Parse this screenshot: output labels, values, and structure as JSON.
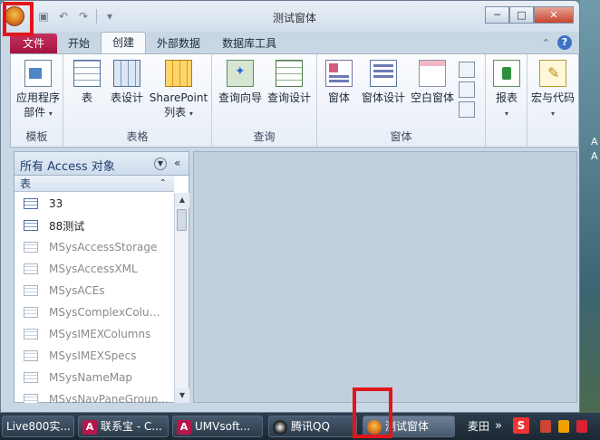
{
  "window": {
    "title": "测试窗体",
    "controls": {
      "minimize": "─",
      "maximize": "□",
      "close": "✕"
    }
  },
  "qat": {
    "undo": "↶",
    "redo": "↷"
  },
  "ribbon": {
    "tabs": [
      {
        "label": "文件"
      },
      {
        "label": "开始"
      },
      {
        "label": "创建"
      },
      {
        "label": "外部数据"
      },
      {
        "label": "数据库工具"
      }
    ],
    "help": "?",
    "groups": [
      {
        "name": "模板",
        "buttons": [
          {
            "label": "应用程序",
            "label2": "部件",
            "icon": "app-parts-icon"
          }
        ]
      },
      {
        "name": "表格",
        "buttons": [
          {
            "label": "表",
            "icon": "table-icon"
          },
          {
            "label": "表设计",
            "icon": "table-design-icon"
          },
          {
            "label": "SharePoint",
            "label2": "列表",
            "icon": "sharepoint-list-icon"
          }
        ]
      },
      {
        "name": "查询",
        "buttons": [
          {
            "label": "查询向导",
            "icon": "query-wizard-icon"
          },
          {
            "label": "查询设计",
            "icon": "query-design-icon"
          }
        ]
      },
      {
        "name": "窗体",
        "buttons": [
          {
            "label": "窗体",
            "icon": "form-icon"
          },
          {
            "label": "窗体设计",
            "icon": "form-design-icon"
          },
          {
            "label": "空白窗体",
            "icon": "blank-form-icon"
          }
        ]
      },
      {
        "name": "",
        "buttons": [
          {
            "label": "报表",
            "icon": "report-icon"
          }
        ]
      },
      {
        "name": "",
        "buttons": [
          {
            "label": "宏与代码",
            "icon": "macro-icon"
          }
        ]
      }
    ]
  },
  "nav": {
    "title": "所有 Access 对象",
    "section": "表",
    "items": [
      {
        "label": "33",
        "system": false
      },
      {
        "label": "88测试",
        "system": false
      },
      {
        "label": "MSysAccessStorage",
        "system": true
      },
      {
        "label": "MSysAccessXML",
        "system": true
      },
      {
        "label": "MSysACEs",
        "system": true
      },
      {
        "label": "MSysComplexColum...",
        "system": true
      },
      {
        "label": "MSysIMEXColumns",
        "system": true
      },
      {
        "label": "MSysIMEXSpecs",
        "system": true
      },
      {
        "label": "MSysNameMap",
        "system": true
      },
      {
        "label": "MSysNavPaneGroup...",
        "system": true
      }
    ]
  },
  "taskbar": {
    "items": [
      {
        "label": "Live800实..."
      },
      {
        "label": "联系宝 - C..."
      },
      {
        "label": "UMVsoft..."
      },
      {
        "label": "腾讯QQ"
      },
      {
        "label": "测试窗体"
      }
    ],
    "tray_text": "麦田",
    "tray_more": "»",
    "tray_s": "S"
  },
  "desktop_right": {
    "labels": [
      "A",
      "A"
    ]
  },
  "colors": {
    "highlight": "#e0161a",
    "file_tab": "#b5174a"
  }
}
